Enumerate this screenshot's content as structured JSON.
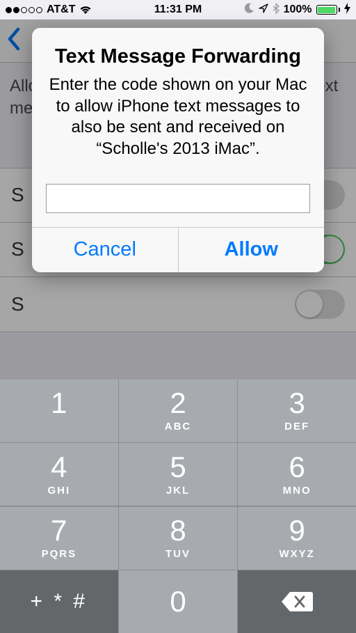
{
  "status_bar": {
    "carrier": "AT&T",
    "time": "11:31 PM",
    "battery_pct": "100%"
  },
  "background": {
    "description": "Allow these devices to send and receive text messages from this iPhone.",
    "rows": [
      "S",
      "S",
      "S"
    ]
  },
  "alert": {
    "title": "Text Message Forwarding",
    "message": "Enter the code shown on your Mac to allow iPhone text messages to also be sent and received on “Scholle's 2013 iMac”.",
    "input_value": "",
    "cancel": "Cancel",
    "allow": "Allow"
  },
  "keypad": {
    "keys": [
      {
        "num": "1",
        "sub": ""
      },
      {
        "num": "2",
        "sub": "ABC"
      },
      {
        "num": "3",
        "sub": "DEF"
      },
      {
        "num": "4",
        "sub": "GHI"
      },
      {
        "num": "5",
        "sub": "JKL"
      },
      {
        "num": "6",
        "sub": "MNO"
      },
      {
        "num": "7",
        "sub": "PQRS"
      },
      {
        "num": "8",
        "sub": "TUV"
      },
      {
        "num": "9",
        "sub": "WXYZ"
      }
    ],
    "symbols": "+ * #",
    "zero": "0"
  }
}
